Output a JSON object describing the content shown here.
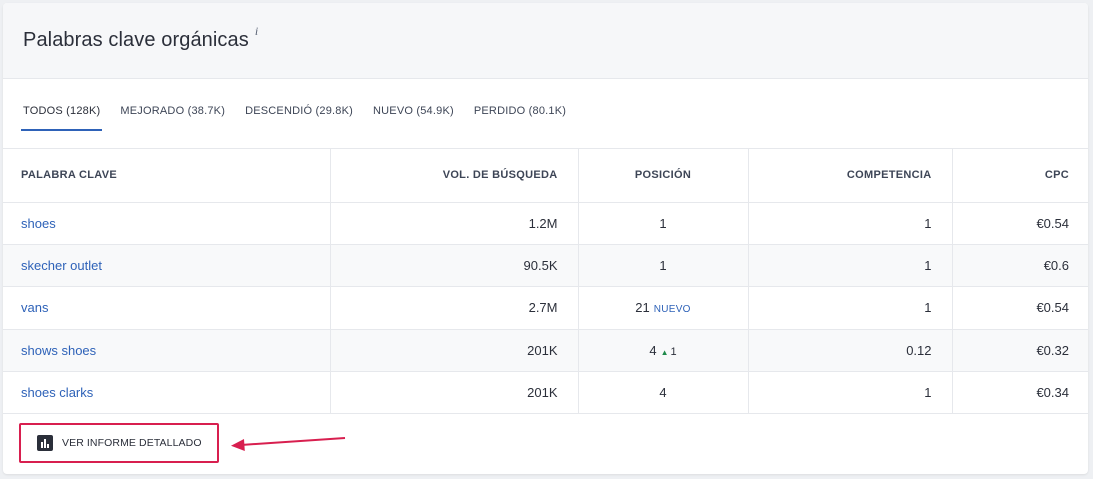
{
  "widget": {
    "title": "Palabras clave orgánicas",
    "info_icon": "i"
  },
  "tabs": [
    {
      "label": "TODOS (128K)",
      "active": true
    },
    {
      "label": "MEJORADO (38.7K)",
      "active": false
    },
    {
      "label": "DESCENDIÓ (29.8K)",
      "active": false
    },
    {
      "label": "NUEVO (54.9K)",
      "active": false
    },
    {
      "label": "PERDIDO (80.1K)",
      "active": false
    }
  ],
  "table": {
    "headers": {
      "keyword": "PALABRA CLAVE",
      "volume": "VOL. DE BÚSQUEDA",
      "position": "POSICIÓN",
      "competition": "COMPETENCIA",
      "cpc": "CPC"
    },
    "rows": [
      {
        "keyword": "shoes",
        "volume": "1.2M",
        "position": "1",
        "position_note": "",
        "position_change": "",
        "competition": "1",
        "cpc": "€0.54"
      },
      {
        "keyword": "skecher outlet",
        "volume": "90.5K",
        "position": "1",
        "position_note": "",
        "position_change": "",
        "competition": "1",
        "cpc": "€0.6"
      },
      {
        "keyword": "vans",
        "volume": "2.7M",
        "position": "21",
        "position_note": "NUEVO",
        "position_change": "",
        "competition": "1",
        "cpc": "€0.54"
      },
      {
        "keyword": "shows shoes",
        "volume": "201K",
        "position": "4",
        "position_note": "",
        "position_change": "1",
        "competition": "0.12",
        "cpc": "€0.32"
      },
      {
        "keyword": "shoes clarks",
        "volume": "201K",
        "position": "4",
        "position_note": "",
        "position_change": "",
        "competition": "1",
        "cpc": "€0.34"
      }
    ]
  },
  "footer": {
    "report_button_label": "VER INFORME DETALLADO",
    "report_icon": "bar-chart-icon",
    "highlight_color": "#d81f4f"
  },
  "colors": {
    "link": "#2e62b8",
    "trend_up": "#1e8a4a"
  }
}
